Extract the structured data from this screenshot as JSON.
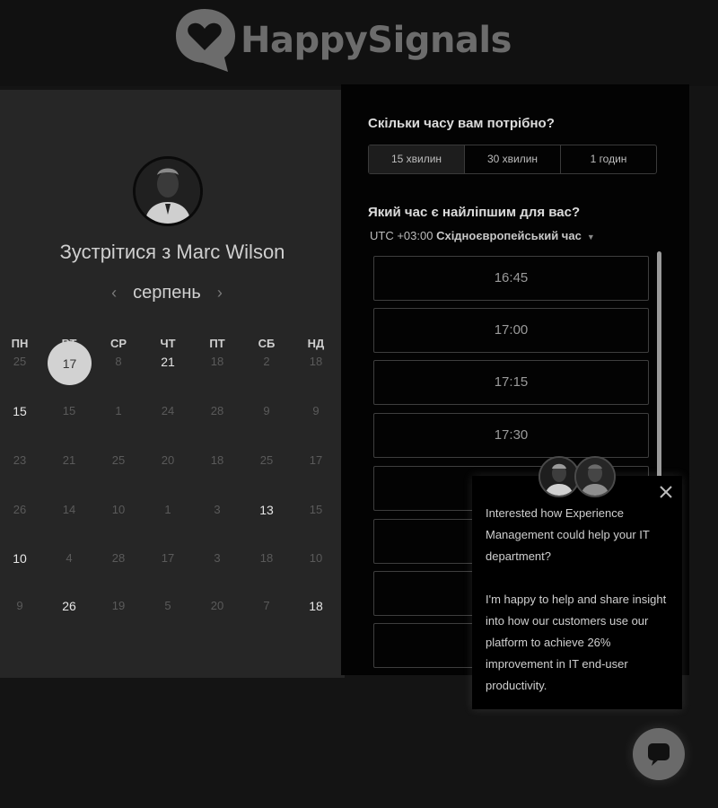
{
  "brand": {
    "name": "HappySignals"
  },
  "calendar": {
    "title": "Зустрітися з Marc Wilson",
    "month": "серпень",
    "weekdays": [
      "ПН",
      "ВТ",
      "СР",
      "ЧТ",
      "ПТ",
      "СБ",
      "НД"
    ],
    "selected_day": "17",
    "rows": [
      [
        [
          "25",
          false
        ],
        [
          "",
          false
        ],
        [
          "8",
          false
        ],
        [
          "21",
          true
        ],
        [
          "18",
          false
        ],
        [
          "2",
          false
        ],
        [
          "18",
          false
        ]
      ],
      [
        [
          "15",
          true
        ],
        [
          "15",
          false
        ],
        [
          "1",
          false
        ],
        [
          "24",
          false
        ],
        [
          "28",
          false
        ],
        [
          "9",
          false
        ],
        [
          "9",
          false
        ]
      ],
      [
        [
          "23",
          false
        ],
        [
          "21",
          false
        ],
        [
          "25",
          false
        ],
        [
          "20",
          false
        ],
        [
          "18",
          false
        ],
        [
          "25",
          false
        ],
        [
          "17",
          false
        ]
      ],
      [
        [
          "26",
          false
        ],
        [
          "14",
          false
        ],
        [
          "10",
          false
        ],
        [
          "1",
          false
        ],
        [
          "3",
          false
        ],
        [
          "13",
          true
        ],
        [
          "15",
          false
        ]
      ],
      [
        [
          "10",
          true
        ],
        [
          "4",
          false
        ],
        [
          "28",
          false
        ],
        [
          "17",
          false
        ],
        [
          "3",
          false
        ],
        [
          "18",
          false
        ],
        [
          "10",
          false
        ]
      ],
      [
        [
          "9",
          false
        ],
        [
          "26",
          true
        ],
        [
          "19",
          false
        ],
        [
          "5",
          false
        ],
        [
          "20",
          false
        ],
        [
          "7",
          false
        ],
        [
          "18",
          true
        ]
      ]
    ]
  },
  "booking": {
    "duration_question": "Скільки часу вам потрібно?",
    "durations": [
      "15 хвилин",
      "30 хвилин",
      "1 годин"
    ],
    "time_question": "Який час є найліпшим для вас?",
    "timezone_offset": "UTC +03:00",
    "timezone_name": "Східноєвропейський час",
    "slots": [
      "16:45",
      "17:00",
      "17:15",
      "17:30",
      "",
      "",
      "",
      ""
    ]
  },
  "chat_popup": {
    "paragraph1": "Interested how Experience Management could help your IT department?",
    "paragraph2": "I'm happy to help and share insight into how our customers use our platform to achieve 26% improvement in IT end-user productivity."
  },
  "icons": {
    "logo": "heart-speech-bubble-icon",
    "close": "close-icon",
    "chat": "chat-bubble-icon"
  },
  "colors": {
    "background": "#141414",
    "left_panel": "#262626",
    "right_panel": "#030303",
    "selected_day": "#d2d2d2",
    "logo_gray": "#6c6c6c"
  }
}
